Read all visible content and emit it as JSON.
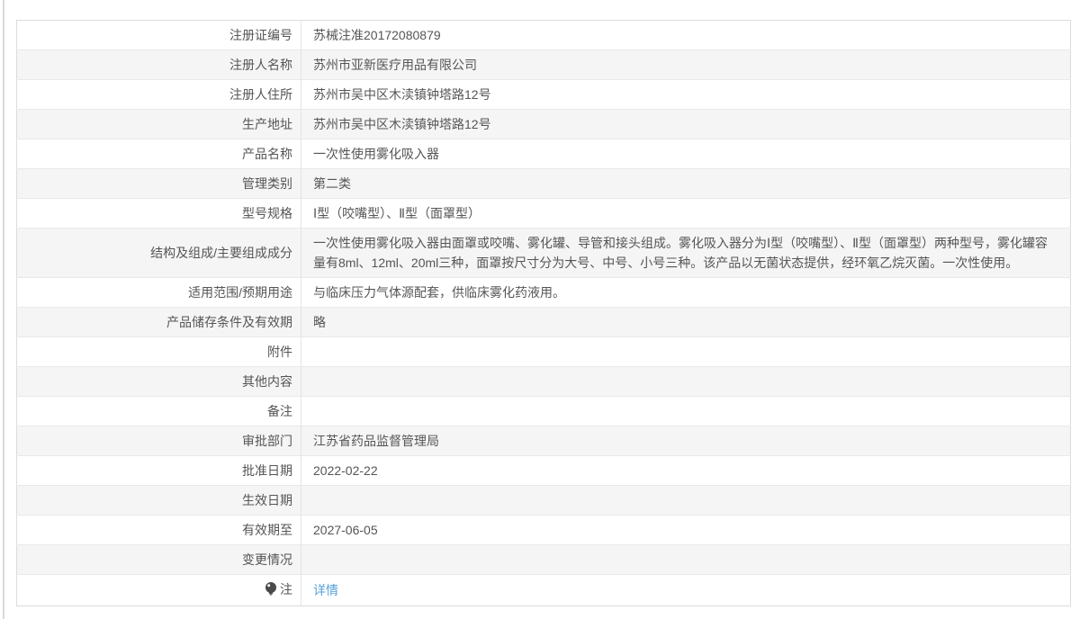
{
  "page": {
    "background_color": "#ffffff",
    "edge_line_color": "#dadada"
  },
  "table": {
    "border_color": "#dcdcdc",
    "row_divider_color": "#e9e9e9",
    "stripe_color": "#f5f5f5",
    "text_color": "#555555",
    "link_color": "#56a0d9",
    "rows": [
      {
        "label": "注册证编号",
        "value": "苏械注准20172080879"
      },
      {
        "label": "注册人名称",
        "value": "苏州市亚新医疗用品有限公司"
      },
      {
        "label": "注册人住所",
        "value": "苏州市吴中区木渎镇钟塔路12号"
      },
      {
        "label": "生产地址",
        "value": "苏州市吴中区木渎镇钟塔路12号"
      },
      {
        "label": "产品名称",
        "value": "一次性使用雾化吸入器"
      },
      {
        "label": "管理类别",
        "value": "第二类"
      },
      {
        "label": "型号规格",
        "value": "Ⅰ型（咬嘴型）、Ⅱ型（面罩型）"
      },
      {
        "label": "结构及组成/主要组成成分",
        "value": "一次性使用雾化吸入器由面罩或咬嘴、雾化罐、导管和接头组成。雾化吸入器分为Ⅰ型（咬嘴型）、Ⅱ型（面罩型）两种型号，雾化罐容量有8ml、12ml、20ml三种，面罩按尺寸分为大号、中号、小号三种。该产品以无菌状态提供，经环氧乙烷灭菌。一次性使用。"
      },
      {
        "label": "适用范围/预期用途",
        "value": "与临床压力气体源配套，供临床雾化药液用。"
      },
      {
        "label": "产品储存条件及有效期",
        "value": "略"
      },
      {
        "label": "附件",
        "value": ""
      },
      {
        "label": "其他内容",
        "value": ""
      },
      {
        "label": "备注",
        "value": ""
      },
      {
        "label": "审批部门",
        "value": "江苏省药品监督管理局"
      },
      {
        "label": "批准日期",
        "value": "2022-02-22"
      },
      {
        "label": "生效日期",
        "value": ""
      },
      {
        "label": "有效期至",
        "value": "2027-06-05"
      },
      {
        "label": "变更情况",
        "value": ""
      },
      {
        "label": "注",
        "icon": "note-bulb-icon",
        "link": "详情"
      }
    ]
  }
}
